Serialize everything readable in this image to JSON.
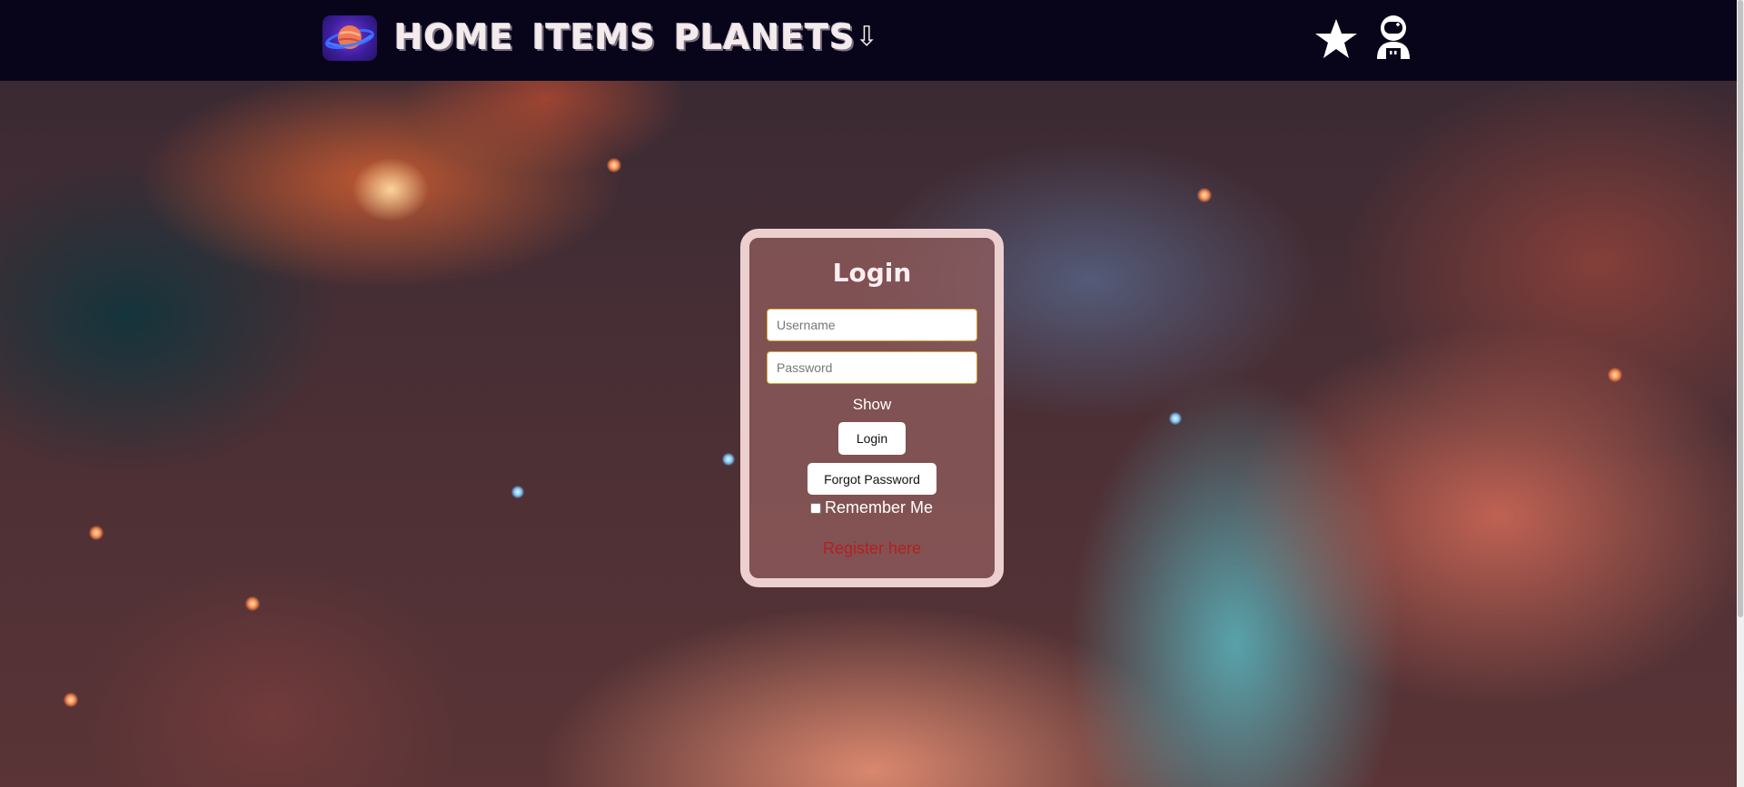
{
  "header": {
    "nav": {
      "home": "HOME",
      "items": "ITEMS",
      "planets": "PLANETS",
      "planets_arrow": "⇩"
    },
    "icons": {
      "logo": "planet-logo-icon",
      "favorites": "star-icon",
      "profile": "astronaut-icon"
    }
  },
  "login": {
    "title": "Login",
    "username_placeholder": "Username",
    "password_placeholder": "Password",
    "username_value": "",
    "password_value": "",
    "show_label": "Show",
    "login_button": "Login",
    "forgot_button": "Forgot Password",
    "remember_label": "Remember Me",
    "remember_checked": false,
    "register_link": "Register here"
  },
  "colors": {
    "header_bg": "#08051a",
    "card_border": "#ecd0d0",
    "input_border": "#d8a436",
    "register_link": "#b42020"
  }
}
